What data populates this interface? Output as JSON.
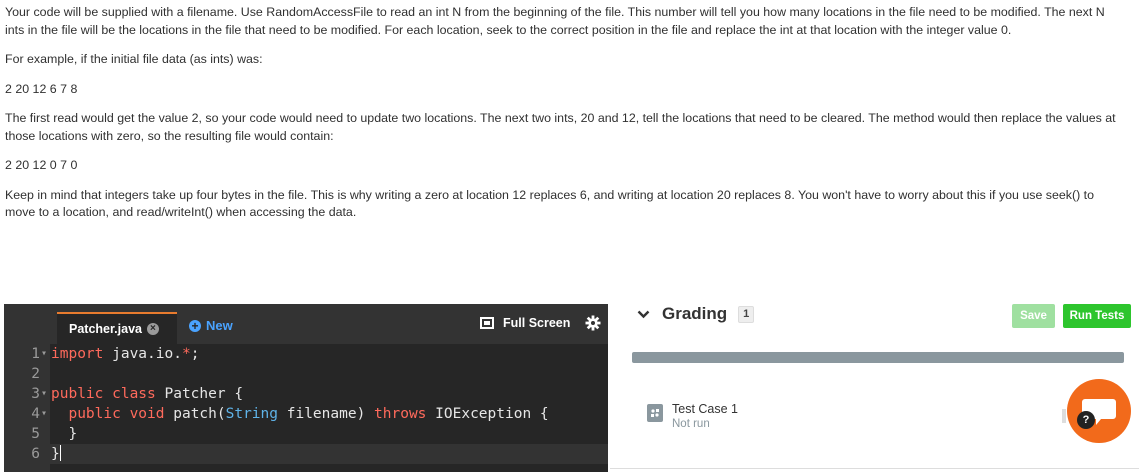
{
  "instructions": {
    "p1": "Your code will be supplied with a filename.  Use RandomAccessFile to read an int N from the beginning of the file.  This number will tell you how many locations in the file need to be modified.  The next N ints in the file will be the locations in the file that need to be modified.  For each location, seek to the correct position in the file and replace the int at that location with the integer value 0.",
    "p2": "For example, if the initial file data (as ints) was:",
    "p3": "2 20 12 6 7 8",
    "p4": "The first read would get the value 2, so your code would need to update two locations.  The next two ints, 20 and 12, tell the locations that need to be cleared.  The method would then replace the values at those locations with zero, so the resulting file would contain:",
    "p5": "2 20 12 0 7 0",
    "p6": "Keep in mind that integers take up four bytes in the file.  This is why writing a zero at location 12 replaces 6, and writing at location 20 replaces 8.  You won't have to worry about this if you use seek() to move to a location, and read/writeInt() when accessing the data."
  },
  "editor": {
    "file_tab": "Patcher.java",
    "new_label": "New",
    "fullscreen_label": "Full Screen",
    "lines": [
      {
        "n": "1",
        "fold": true
      },
      {
        "n": "2",
        "fold": false
      },
      {
        "n": "3",
        "fold": true
      },
      {
        "n": "4",
        "fold": true
      },
      {
        "n": "5",
        "fold": false
      },
      {
        "n": "6",
        "fold": false
      }
    ],
    "tokens": {
      "l1_kw": "import",
      "l1_pkg": " java.io.",
      "l1_star": "*",
      "l1_end": ";",
      "l3_kw": "public class",
      "l3_rest": " Patcher {",
      "l4_indent": "  ",
      "l4_kw1": "public void",
      "l4_mid": " patch(",
      "l4_type": "String",
      "l4_mid2": " filename) ",
      "l4_kw2": "throws",
      "l4_rest": " IOException {",
      "l5": "  }",
      "l6": "}"
    }
  },
  "grading": {
    "title": "Grading",
    "count": "1",
    "save_label": "Save",
    "run_label": "Run Tests",
    "progress": 0,
    "test_case": {
      "name": "Test Case 1",
      "status": "Not run"
    },
    "help_label": "?"
  }
}
